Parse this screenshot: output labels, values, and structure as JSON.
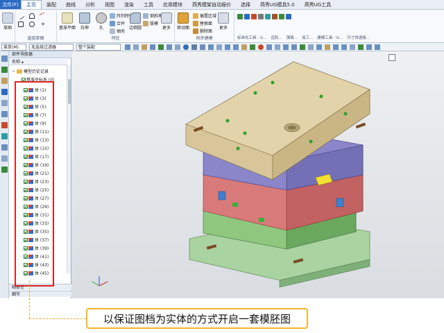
{
  "menu": {
    "file": "文件(F)",
    "tabs": [
      "主页",
      "装配",
      "曲线",
      "分析",
      "视图",
      "渲染",
      "工具",
      "应用模块",
      "燕秀模架自动报价",
      "选择",
      "燕秀UG模具5.0",
      "燕秀UG工具"
    ],
    "active_tab": "主页"
  },
  "ribbon": {
    "sketch_label": "草图",
    "groups": [
      "直接草图",
      "特征",
      "同步建模",
      "标准化工具 - G...",
      "齿轮...",
      "弹簧...",
      "加工...",
      "建模工具 - G...",
      "尺寸快速格..."
    ],
    "buttons": {
      "datum": "基准平面",
      "extrude": "拉伸",
      "hole": "孔",
      "pattern": "阵列特征",
      "unite": "合并",
      "shell": "抽壳",
      "edge_blend": "边倒圆",
      "chamfer": "倒斜角",
      "draft": "拔模",
      "more1": "更多",
      "move_face": "移动面",
      "offset_region": "偏置区域",
      "replace_face": "替换面",
      "delete_face": "删除面",
      "more2": "更多"
    }
  },
  "toolbar": {
    "menu_label": "菜单(M)",
    "filter": "无选择过滤器",
    "scope": "整个装配"
  },
  "navigator": {
    "title": "部件导航器",
    "column": "名称",
    "root": "模型历史记录",
    "sub": "基准坐标系 (0)",
    "items": [
      "体 (1)",
      "体 (3)",
      "体 (5)",
      "体 (7)",
      "体 (9)",
      "体 (11)",
      "体 (13)",
      "体 (15)",
      "体 (17)",
      "体 (19)",
      "体 (21)",
      "体 (23)",
      "体 (25)",
      "体 (27)",
      "体 (29)",
      "体 (31)",
      "体 (33)",
      "体 (35)",
      "体 (37)",
      "体 (39)",
      "体 (41)",
      "体 (43)",
      "体 (45)"
    ],
    "panels": [
      "相依性",
      "细节"
    ]
  },
  "caption": "以保证图档为实体的方式开启一套模胚图",
  "colors": {
    "accent": "#2b6bc4",
    "highlight_box": "#e02020",
    "callout_border": "#f2b627"
  }
}
